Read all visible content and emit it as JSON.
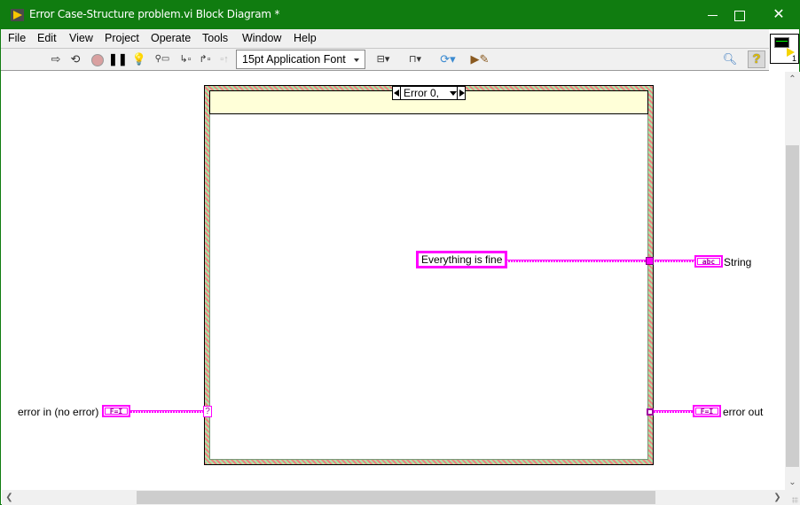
{
  "window": {
    "title": "Error Case-Structure problem.vi Block Diagram *"
  },
  "menu": {
    "items": [
      "File",
      "Edit",
      "View",
      "Project",
      "Operate",
      "Tools",
      "Window",
      "Help"
    ]
  },
  "toolbar": {
    "font_select": "15pt Application Font",
    "icons": [
      "run-arrow-icon",
      "run-continuously-icon",
      "abort-icon",
      "pause-icon",
      "highlight-execution-icon",
      "retain-wire-values-icon",
      "step-into-icon",
      "step-over-icon",
      "step-out-icon",
      "align-objects-icon",
      "distribute-objects-icon",
      "reorder-icon",
      "clean-up-diagram-icon",
      "search-icon",
      "context-help-icon"
    ],
    "help_glyph": "?"
  },
  "vi_icon": {
    "number": "1"
  },
  "diagram": {
    "case_selector": {
      "label": "Error 0,"
    },
    "string_constant": "Everything is fine",
    "tunnel_error_in": "?",
    "terminals": {
      "string_indicator": {
        "label": "String",
        "glyph": "abc"
      },
      "error_in": {
        "label": "error in (no error)",
        "glyph": "F=I"
      },
      "error_out": {
        "label": "error out",
        "glyph": "F=I"
      }
    },
    "colors": {
      "string_wire": "#ff00ff",
      "case_header": "#ffffd8",
      "title_bar": "#107c10"
    }
  }
}
